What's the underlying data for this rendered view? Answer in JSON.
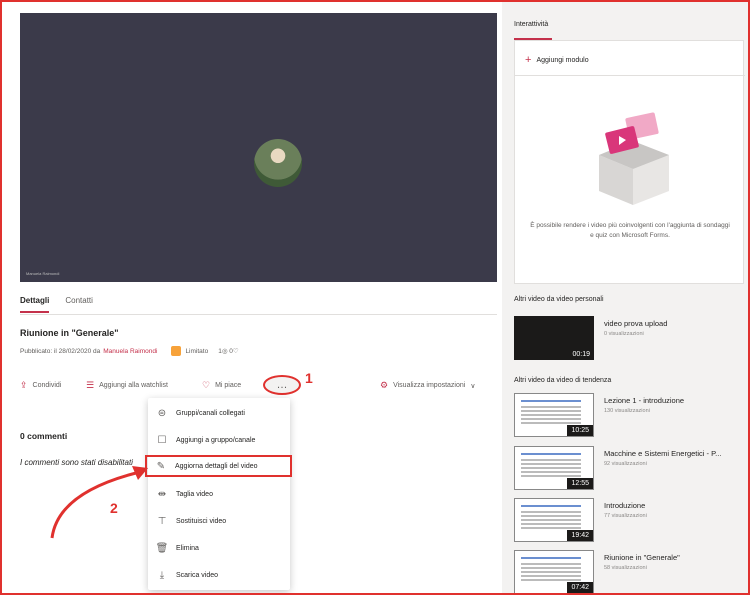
{
  "player": {
    "tag": "Manuela Raimondi"
  },
  "tabs": [
    {
      "label": "Dettagli"
    },
    {
      "label": "Contatti"
    }
  ],
  "video": {
    "title": "Riunione in \"Generale\"",
    "published_prefix": "Pubblicato: il 28/02/2020 da",
    "author": "Manuela Raimondi",
    "access": "Limitato",
    "counts": "1◎ 0♡"
  },
  "actions": {
    "share": "Condividi",
    "watchlist": "Aggiungi alla watchlist",
    "like": "Mi piace",
    "more": "…",
    "settings": "Visualizza impostazioni"
  },
  "callouts": {
    "one": "1",
    "two": "2"
  },
  "comments": {
    "heading": "0 commenti",
    "disabled": "I commenti sono stati disabilitati"
  },
  "menu": [
    {
      "label": "Gruppi/canali collegati",
      "icon": "group-icon"
    },
    {
      "label": "Aggiungi a gruppo/canale",
      "icon": "add-to-group-icon"
    },
    {
      "label": "Aggiorna dettagli del video",
      "icon": "pencil-icon",
      "highlighted": true
    },
    {
      "label": "Taglia video",
      "icon": "trim-icon"
    },
    {
      "label": "Sostituisci video",
      "icon": "replace-icon"
    },
    {
      "label": "Elimina",
      "icon": "trash-icon"
    },
    {
      "label": "Scarica video",
      "icon": "download-icon"
    }
  ],
  "sidebar": {
    "interactivity": "Interattività",
    "add_module": "Aggiungi modulo",
    "card_text": "È possibile rendere i video più coinvolgenti con l'aggiunta di sondaggi e quiz con Microsoft Forms.",
    "personal_heading": "Altri video da video personali",
    "personal": [
      {
        "title": "video prova upload",
        "views": "0 visualizzazioni",
        "duration": "00:19"
      }
    ],
    "trending_heading": "Altri video da video di tendenza",
    "trending": [
      {
        "title": "Lezione 1 - introduzione",
        "views": "130 visualizzazioni",
        "duration": "10:25"
      },
      {
        "title": "Macchine e Sistemi Energetici - P...",
        "views": "92 visualizzazioni",
        "duration": "12:55"
      },
      {
        "title": "Introduzione",
        "views": "77 visualizzazioni",
        "duration": "19:42"
      },
      {
        "title": "Riunione in \"Generale\"",
        "views": "58 visualizzazioni",
        "duration": "07:42"
      }
    ]
  },
  "colors": {
    "accent": "#c4314b",
    "annotation": "#e0312e",
    "player_bg": "#3b3a4a"
  }
}
